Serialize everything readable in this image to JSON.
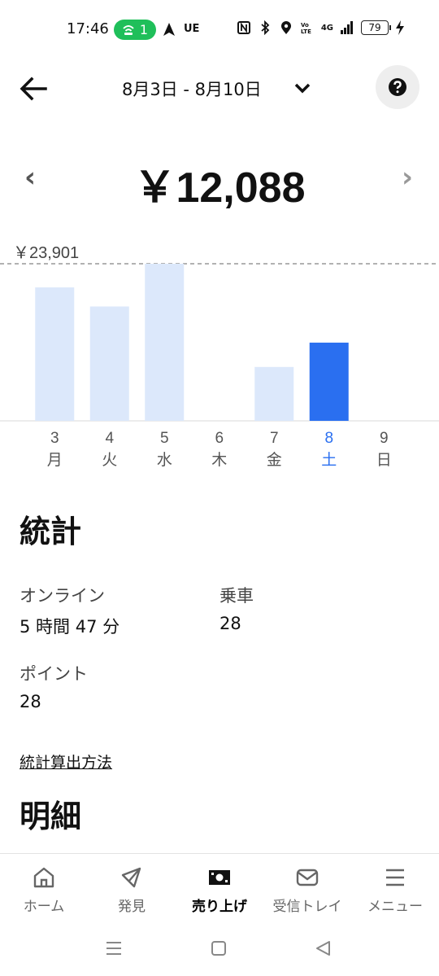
{
  "status_bar": {
    "time": "17:46",
    "hotspot_count": "1",
    "carrier_text": "UE",
    "network_text": "4G",
    "battery": "79"
  },
  "header": {
    "date_range": "8月3日 - 8月10日"
  },
  "summary": {
    "amount": "￥12,088"
  },
  "chart_data": {
    "type": "bar",
    "max_label": "￥23,901",
    "max_value": 23901,
    "days": [
      "3",
      "4",
      "5",
      "6",
      "7",
      "8",
      "9"
    ],
    "weekdays": [
      "月",
      "火",
      "水",
      "木",
      "金",
      "土",
      "日"
    ],
    "values": [
      20300,
      17400,
      23901,
      0,
      8200,
      11900,
      0
    ],
    "selected_index": 5,
    "colors": {
      "bar": "#dce8fb",
      "selected": "#2a6ff0",
      "selected_label": "#2a6ff0",
      "label": "#555555"
    }
  },
  "stats": {
    "title": "統計",
    "online_label": "オンライン",
    "online_value": "5 時間 47 分",
    "rides_label": "乗車",
    "rides_value": "28",
    "points_label": "ポイント",
    "points_value": "28",
    "method_link": "統計算出方法"
  },
  "details": {
    "title": "明細"
  },
  "bottom_nav": {
    "items": [
      {
        "label": "ホーム",
        "icon": "home-icon"
      },
      {
        "label": "発見",
        "icon": "compass-icon"
      },
      {
        "label": "売り上げ",
        "icon": "earnings-icon"
      },
      {
        "label": "受信トレイ",
        "icon": "inbox-icon"
      },
      {
        "label": "メニュー",
        "icon": "menu-icon"
      }
    ],
    "active_index": 2
  }
}
